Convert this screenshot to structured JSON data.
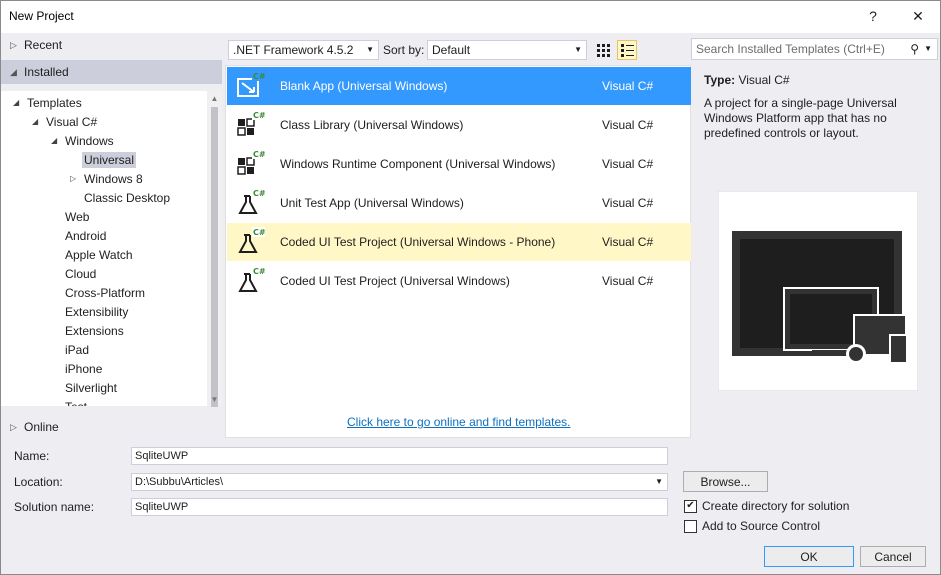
{
  "window": {
    "title": "New Project",
    "help_glyph": "?",
    "close_glyph": "✕"
  },
  "sidebar": {
    "recent_label": "Recent",
    "installed_label": "Installed",
    "online_label": "Online",
    "tree": [
      {
        "label": "Templates",
        "level": 0,
        "expander": "◢",
        "selected": false
      },
      {
        "label": "Visual C#",
        "level": 1,
        "expander": "◢",
        "selected": false
      },
      {
        "label": "Windows",
        "level": 2,
        "expander": "◢",
        "selected": false
      },
      {
        "label": "Universal",
        "level": 3,
        "expander": "",
        "selected": true
      },
      {
        "label": "Windows 8",
        "level": 3,
        "expander": "▷",
        "selected": false
      },
      {
        "label": "Classic Desktop",
        "level": 3,
        "expander": "",
        "selected": false
      },
      {
        "label": "Web",
        "level": 2,
        "expander": "",
        "selected": false
      },
      {
        "label": "Android",
        "level": 2,
        "expander": "",
        "selected": false
      },
      {
        "label": "Apple Watch",
        "level": 2,
        "expander": "",
        "selected": false
      },
      {
        "label": "Cloud",
        "level": 2,
        "expander": "",
        "selected": false
      },
      {
        "label": "Cross-Platform",
        "level": 2,
        "expander": "",
        "selected": false
      },
      {
        "label": "Extensibility",
        "level": 2,
        "expander": "",
        "selected": false
      },
      {
        "label": "Extensions",
        "level": 2,
        "expander": "",
        "selected": false
      },
      {
        "label": "iPad",
        "level": 2,
        "expander": "",
        "selected": false
      },
      {
        "label": "iPhone",
        "level": 2,
        "expander": "",
        "selected": false
      },
      {
        "label": "Silverlight",
        "level": 2,
        "expander": "",
        "selected": false
      },
      {
        "label": "Test",
        "level": 2,
        "expander": "",
        "selected": false
      }
    ]
  },
  "toolbar": {
    "framework": ".NET Framework 4.5.2",
    "sort_by_label": "Sort by:",
    "sort_value": "Default"
  },
  "search": {
    "placeholder": "Search Installed Templates (Ctrl+E)"
  },
  "templates": [
    {
      "name": "Blank App (Universal Windows)",
      "lang": "Visual C#",
      "state": "selected",
      "icon": "blank-app-icon"
    },
    {
      "name": "Class Library (Universal Windows)",
      "lang": "Visual C#",
      "state": "normal",
      "icon": "class-library-icon"
    },
    {
      "name": "Windows Runtime Component (Universal Windows)",
      "lang": "Visual C#",
      "state": "normal",
      "icon": "runtime-component-icon"
    },
    {
      "name": "Unit Test App (Universal Windows)",
      "lang": "Visual C#",
      "state": "normal",
      "icon": "unit-test-icon"
    },
    {
      "name": "Coded UI Test Project (Universal Windows - Phone)",
      "lang": "Visual C#",
      "state": "hover",
      "icon": "coded-ui-test-icon"
    },
    {
      "name": "Coded UI Test Project (Universal Windows)",
      "lang": "Visual C#",
      "state": "normal",
      "icon": "coded-ui-test-icon"
    }
  ],
  "online_link": "Click here to go online and find templates.",
  "details": {
    "type_label": "Type:",
    "type_value": "Visual C#",
    "description": "A project for a single-page Universal Windows Platform app that has no predefined controls or layout."
  },
  "form": {
    "name_label": "Name:",
    "name_value": "SqliteUWP",
    "location_label": "Location:",
    "location_value": "D:\\Subbu\\Articles\\",
    "solution_label": "Solution name:",
    "solution_value": "SqliteUWP",
    "browse_label": "Browse...",
    "create_dir_label": "Create directory for solution",
    "create_dir_checked": true,
    "source_control_label": "Add to Source Control",
    "source_control_checked": false,
    "ok_label": "OK",
    "cancel_label": "Cancel"
  },
  "colors": {
    "selection": "#3399ff",
    "hover": "#fff8c6",
    "link": "#0e70c0",
    "panel": "#eeeef2"
  }
}
